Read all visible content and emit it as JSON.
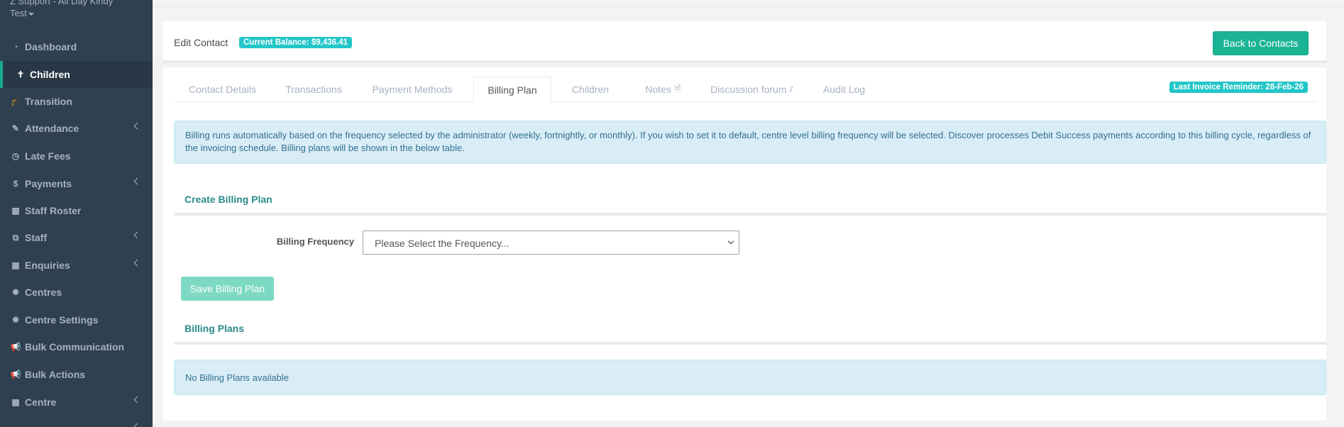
{
  "sidebar": {
    "brand_line1": "Z Support - All Day Kindy",
    "brand_line2": "Test",
    "items": [
      {
        "label": "Dashboard",
        "icon": "dashboard-icon",
        "glyph": "◔"
      },
      {
        "label": "Children",
        "icon": "child-icon",
        "glyph": "✝"
      },
      {
        "label": "Transition",
        "icon": "graduation-cap-icon",
        "glyph": "🎓"
      },
      {
        "label": "Attendance",
        "icon": "edit-icon",
        "glyph": "✎"
      },
      {
        "label": "Late Fees",
        "icon": "clock-icon",
        "glyph": "◷"
      },
      {
        "label": "Payments",
        "icon": "dollar-icon",
        "glyph": "$"
      },
      {
        "label": "Staff Roster",
        "icon": "calendar-icon",
        "glyph": "▦"
      },
      {
        "label": "Staff",
        "icon": "sitemap-icon",
        "glyph": "⧉"
      },
      {
        "label": "Enquiries",
        "icon": "grid-icon",
        "glyph": "▦"
      },
      {
        "label": "Centres",
        "icon": "gear-icon",
        "glyph": "✹"
      },
      {
        "label": "Centre Settings",
        "icon": "gear-icon",
        "glyph": "✹"
      },
      {
        "label": "Bulk Communication",
        "icon": "megaphone-icon",
        "glyph": "📢"
      },
      {
        "label": "Bulk Actions",
        "icon": "megaphone-icon",
        "glyph": "📢"
      },
      {
        "label": "Centre",
        "icon": "grid-icon",
        "glyph": "▦"
      }
    ]
  },
  "header": {
    "title": "Edit Contact",
    "balance_badge": "Current Balance: $9,436.41",
    "back_button": "Back to Contacts"
  },
  "tabs": [
    {
      "label": "Contact Details"
    },
    {
      "label": "Transactions"
    },
    {
      "label": "Payment Methods"
    },
    {
      "label": "Billing Plan"
    },
    {
      "label": "Children"
    },
    {
      "label": "Notes"
    },
    {
      "label": "Discussion forum"
    },
    {
      "label": "Audit Log"
    }
  ],
  "reminder_badge": "Last Invoice Reminder: 28-Feb-26",
  "info_alert": "Billing runs automatically based on the frequency selected by the administrator (weekly, fortnightly, or monthly). If you wish to set it to default, centre level billing frequency will be selected. Discover processes Debit Success payments according to this billing cycle, regardless of the invoicing schedule. Billing plans will be shown in the below table.",
  "create_section": {
    "title": "Create Billing Plan",
    "frequency_label": "Billing Frequency",
    "frequency_value": "Please Select the Frequency...",
    "save_button": "Save Billing Plan"
  },
  "plans_section": {
    "title": "Billing Plans",
    "empty_message": "No Billing Plans available"
  },
  "colors": {
    "sidebar_bg": "#2f4050",
    "accent": "#1ab394",
    "badge": "#23c6c8",
    "section_title": "#2a8a8c"
  }
}
